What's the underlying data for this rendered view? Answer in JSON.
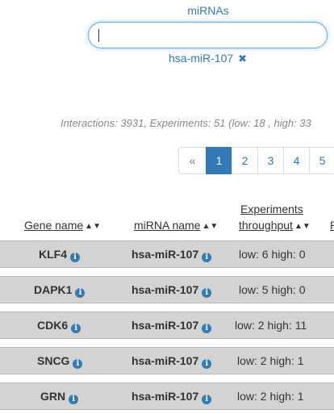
{
  "filter": {
    "label": "miRNAs",
    "input_value": "",
    "selected_chip": "hsa-miR-107",
    "chip_remove_icon": "close-icon"
  },
  "stats_text": "Interactions: 3931, Experiments: 51 (low: 18 , high: 33",
  "pagination": {
    "prev": "«",
    "pages": [
      "1",
      "2",
      "3",
      "4",
      "5"
    ],
    "active": "1"
  },
  "table": {
    "headers": {
      "gene": "Gene name",
      "mirna": "miRNA name",
      "throughput_line1": "Experiments",
      "throughput_line2": "throughput",
      "extra": "P"
    },
    "rows": [
      {
        "gene": "KLF4",
        "mirna": "hsa-miR-107",
        "throughput": "low: 6 high: 0"
      },
      {
        "gene": "DAPK1",
        "mirna": "hsa-miR-107",
        "throughput": "low: 5 high: 0"
      },
      {
        "gene": "CDK6",
        "mirna": "hsa-miR-107",
        "throughput": "low: 2 high: 11"
      },
      {
        "gene": "SNCG",
        "mirna": "hsa-miR-107",
        "throughput": "low: 2 high: 1"
      },
      {
        "gene": "GRN",
        "mirna": "hsa-miR-107",
        "throughput": "low: 2 high: 1"
      }
    ]
  },
  "colors": {
    "accent": "#337ab7",
    "row_bg": "#d3d3d3"
  }
}
